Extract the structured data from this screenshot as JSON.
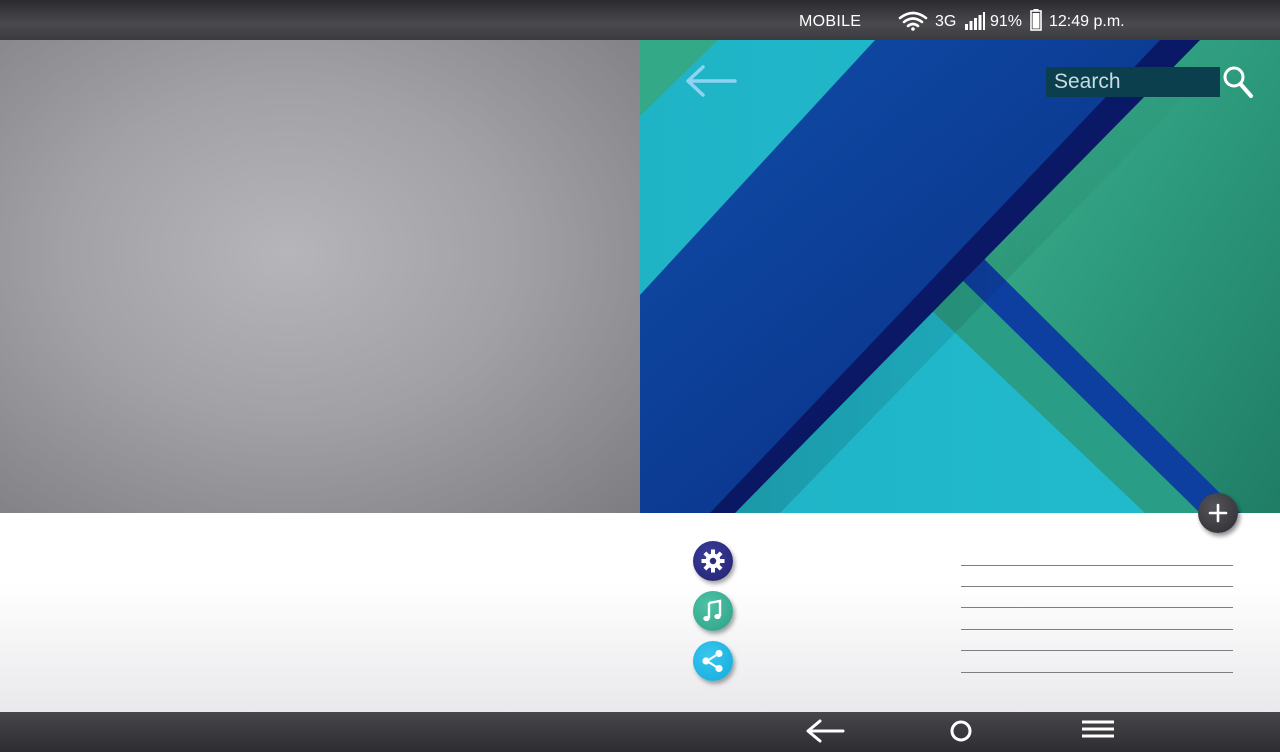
{
  "status_bar": {
    "carrier": "MOBILE",
    "network": "3G",
    "battery_percent": "91%",
    "time": "12:49 p.m."
  },
  "hero": {
    "search_placeholder": "Search",
    "colors": {
      "teal": "#1fb5c8",
      "green": "#37ad8c",
      "dark_green": "#1f7f67",
      "royal_blue": "#0e3f9a",
      "navy": "#0a1060"
    }
  },
  "icons": {
    "back": "arrow-left-icon",
    "search": "search-icon",
    "add": "plus-icon",
    "settings": "gear-icon",
    "music": "music-note-icon",
    "share": "share-icon",
    "nav_back": "arrow-left-icon",
    "nav_home": "circle-home-icon",
    "nav_menu": "hamburger-menu-icon"
  },
  "button_colors": {
    "settings": "#2b2b80",
    "music": "#3db596",
    "share": "#22b8e6",
    "fab": "#3a393e"
  }
}
